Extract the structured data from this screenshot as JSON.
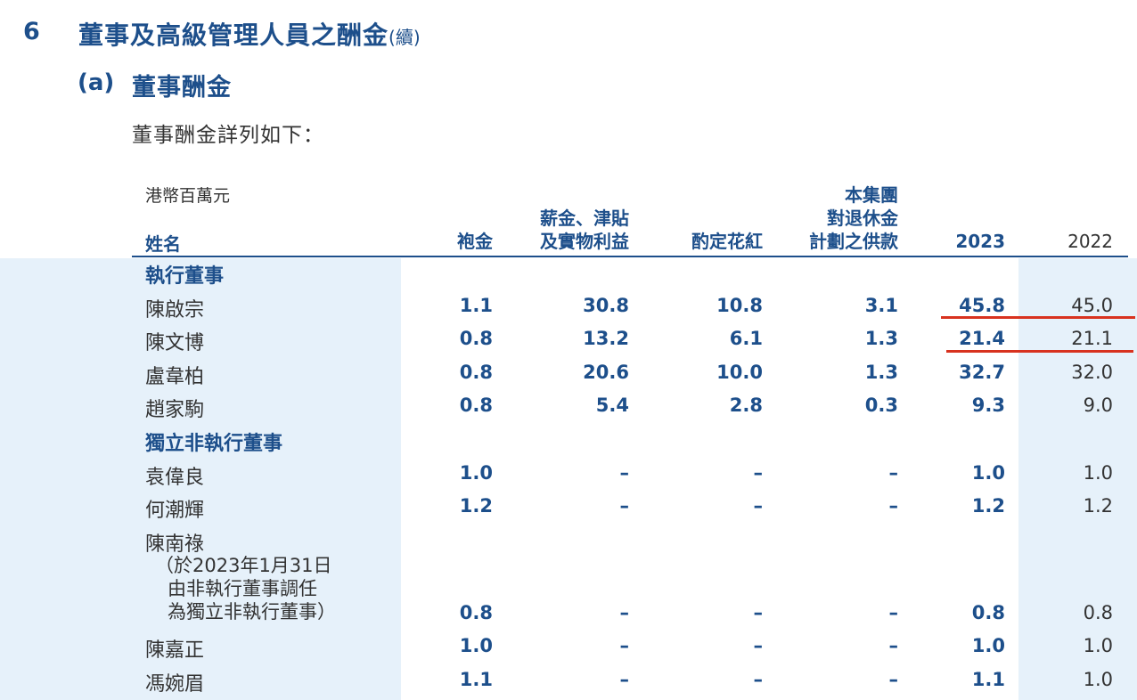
{
  "section": {
    "number": "6",
    "title": "董事及高級管理人員之酬金",
    "continued": "(續)"
  },
  "subsection": {
    "label": "(a)",
    "title": "董事酬金"
  },
  "intro": "董事酬金詳列如下：",
  "table": {
    "unit": "港幣百萬元",
    "name_header": "姓名",
    "headers": [
      "袍金",
      "薪金、津貼|及實物利益",
      "酌定花紅",
      "本集團|對退休金|計劃之供款",
      "2023",
      "2022"
    ],
    "sections": [
      {
        "title": "執行董事",
        "rows": [
          {
            "name": "陳啟宗",
            "values": [
              "1.1",
              "30.8",
              "10.8",
              "3.1",
              "45.8",
              "45.0"
            ]
          },
          {
            "name": "陳文博",
            "values": [
              "0.8",
              "13.2",
              "6.1",
              "1.3",
              "21.4",
              "21.1"
            ]
          },
          {
            "name": "盧韋柏",
            "values": [
              "0.8",
              "20.6",
              "10.0",
              "1.3",
              "32.7",
              "32.0"
            ]
          },
          {
            "name": "趙家駒",
            "values": [
              "0.8",
              "5.4",
              "2.8",
              "0.3",
              "9.3",
              "9.0"
            ]
          }
        ]
      },
      {
        "title": "獨立非執行董事",
        "rows": [
          {
            "name": "袁偉良",
            "values": [
              "1.0",
              "–",
              "–",
              "–",
              "1.0",
              "1.0"
            ]
          },
          {
            "name": "何潮輝",
            "values": [
              "1.2",
              "–",
              "–",
              "–",
              "1.2",
              "1.2"
            ]
          },
          {
            "name": "陳南祿",
            "note": [
              "（於2023年1月31日",
              "由非執行董事調任",
              "為獨立非執行董事）"
            ],
            "values": [
              "0.8",
              "–",
              "–",
              "–",
              "0.8",
              "0.8"
            ]
          },
          {
            "name": "陳嘉正",
            "values": [
              "1.0",
              "–",
              "–",
              "–",
              "1.0",
              "1.0"
            ]
          },
          {
            "name": "馮婉眉",
            "values": [
              "1.1",
              "–",
              "–",
              "–",
              "1.1",
              "1.0"
            ]
          }
        ]
      }
    ]
  },
  "colors": {
    "accent": "#1d4f8b",
    "highlight_bg": "#e6f1fa",
    "annotation": "#d8321f"
  }
}
